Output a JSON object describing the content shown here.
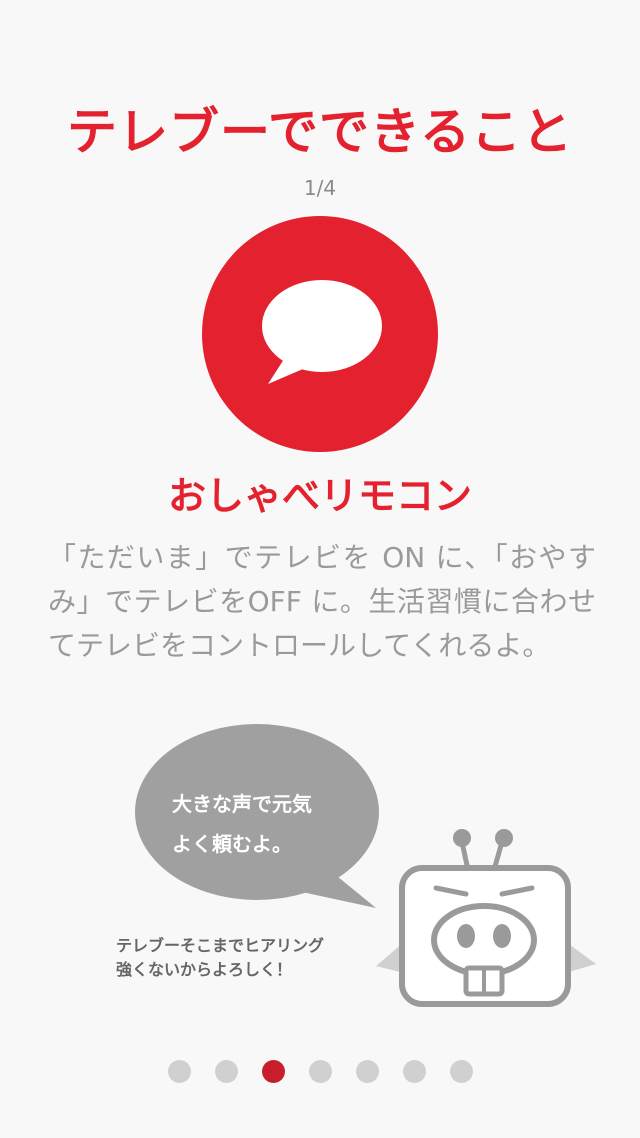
{
  "header": {
    "title": "テレブーでできること",
    "page_indicator": "1/4"
  },
  "feature": {
    "icon": "speech-bubble-icon",
    "name": "おしゃべリモコン",
    "description": "「ただいま」でテレビを ON に、「おやすみ」でテレビをOFF に。生活習慣に合わせてテレビをコントロールしてくれるよ。"
  },
  "mascot_section": {
    "speech_line1": "大きな声で元気",
    "speech_line2": "よく頼むよ。",
    "caption_line1": "テレブーそこまでヒアリング",
    "caption_line2": "強くないからよろしく！"
  },
  "pagination": {
    "count": 7,
    "active_index": 2
  },
  "colors": {
    "accent": "#e4222f",
    "active_dot": "#c81e2c",
    "inactive_dot": "#d0d0d0",
    "bubble": "#a0a0a0",
    "text_gray": "#9a9a9a"
  }
}
